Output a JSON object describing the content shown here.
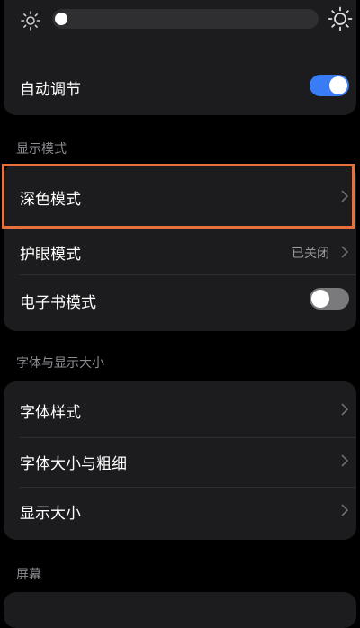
{
  "brightness": {
    "level": 0.0,
    "auto_label": "自动调节",
    "auto_enabled": true,
    "min_icon": "sun-small-icon",
    "max_icon": "sun-large-icon"
  },
  "display_mode": {
    "header": "显示模式",
    "items": [
      {
        "label": "深色模式",
        "value": "",
        "control": "chevron",
        "highlighted": true
      },
      {
        "label": "护眼模式",
        "value": "已关闭",
        "control": "chevron"
      },
      {
        "label": "电子书模式",
        "value": "",
        "control": "toggle",
        "enabled": false
      }
    ]
  },
  "font_size": {
    "header": "字体与显示大小",
    "items": [
      {
        "label": "字体样式",
        "control": "chevron"
      },
      {
        "label": "字体大小与粗细",
        "control": "chevron"
      },
      {
        "label": "显示大小",
        "control": "chevron"
      }
    ]
  },
  "screen": {
    "header": "屏幕"
  },
  "colors": {
    "accent": "#3a7cf5",
    "highlight": "#e8703a",
    "card": "#1c1c1e",
    "background": "#000000"
  }
}
